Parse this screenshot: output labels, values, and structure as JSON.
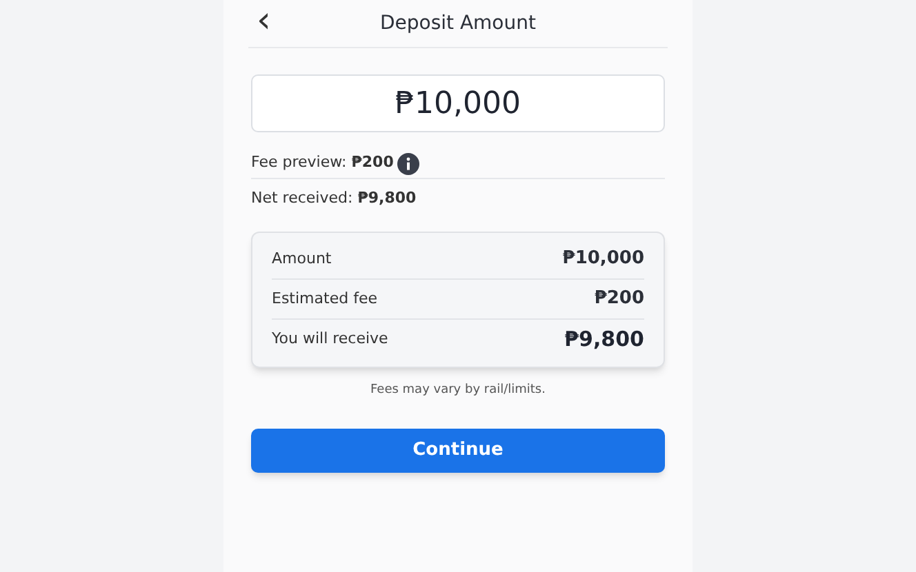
{
  "header": {
    "back": "‹",
    "title": "Deposit Amount"
  },
  "amount_field": {
    "value": "₱10,000"
  },
  "fee_preview": "Fee preview: **₱200**",
  "net_received": "Net received: **₱9,800**",
  "summary": [
    {
      "label": "Amount",
      "value": "₱10,000",
      "kind": "normal"
    },
    {
      "label": "Estimated fee",
      "value": "₱200",
      "kind": "normal"
    },
    {
      "label": "You will receive",
      "value": "₱9,800",
      "kind": "total"
    }
  ],
  "note": "Fees may vary by rail/limits.",
  "button": "Continue"
}
